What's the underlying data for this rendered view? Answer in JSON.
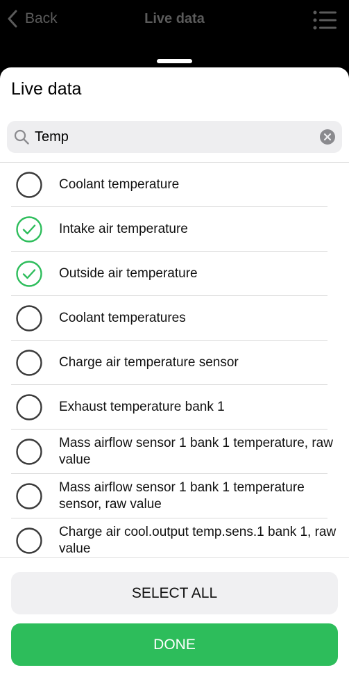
{
  "nav": {
    "back_label": "Back",
    "title": "Live data",
    "menu_icon": "list-icon"
  },
  "sheet": {
    "title": "Live data"
  },
  "search": {
    "value": "Temp",
    "icon": "search-icon",
    "clear_icon": "clear-icon"
  },
  "items": [
    {
      "label": "Coolant temperature",
      "checked": false
    },
    {
      "label": "Intake air temperature",
      "checked": true
    },
    {
      "label": "Outside air temperature",
      "checked": true
    },
    {
      "label": "Coolant temperatures",
      "checked": false
    },
    {
      "label": "Charge air temperature sensor",
      "checked": false
    },
    {
      "label": "Exhaust temperature bank 1",
      "checked": false
    },
    {
      "label": "Mass airflow sensor 1 bank 1 temperature, raw value",
      "checked": false
    },
    {
      "label": "Mass airflow sensor 1 bank 1 temperature sensor, raw value",
      "checked": false
    },
    {
      "label": "Charge air cool.output temp.sens.1 bank 1, raw value",
      "checked": false
    }
  ],
  "buttons": {
    "select_all": "SELECT ALL",
    "done": "DONE"
  },
  "colors": {
    "accent_green": "#2dbd5b",
    "checkbox_border": "#3a3a3a"
  }
}
